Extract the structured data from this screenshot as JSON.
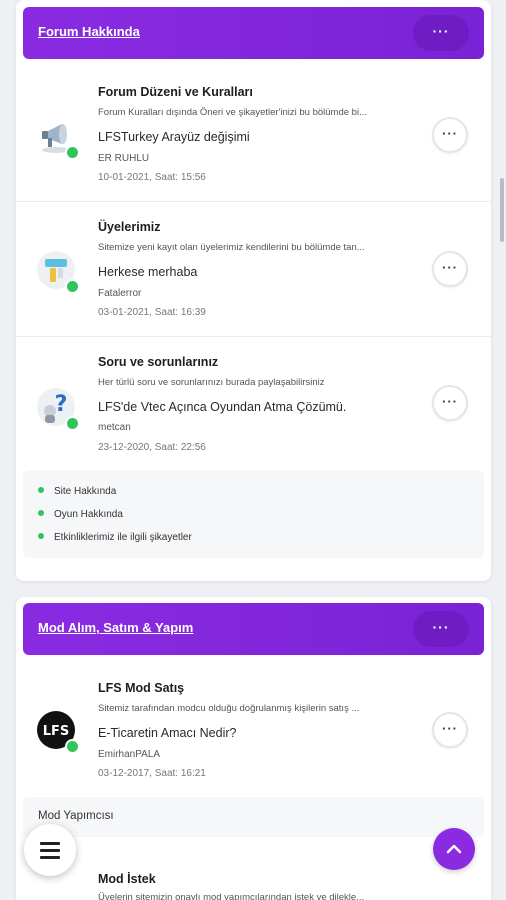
{
  "categories": [
    {
      "title": "Forum Hakkında",
      "more_label": "···",
      "forums": [
        {
          "title": "Forum Düzeni ve Kuralları",
          "description": "Forum Kuralları dışında Öneri ve şikayetler'inizi bu bölümde bi...",
          "last_thread": "LFSTurkey Arayüz değişimi",
          "last_user": "ER RUHLU",
          "last_date": "10-01-2021, Saat: 15:56",
          "icon": "megaphone-icon",
          "more_label": "···"
        },
        {
          "title": "Üyelerimiz",
          "description": "Sitemize yeni kayıt olan üyelerimiz kendilerini bu bölümde tan...",
          "last_thread": "Herkese merhaba",
          "last_user": "Fatalerror",
          "last_date": "03-01-2021, Saat: 16:39",
          "icon": "members-icon",
          "more_label": "···"
        },
        {
          "title": "Soru ve sorunlarınız",
          "description": "Her türlü soru ve sorunlarınızı burada paylaşabilirsiniz",
          "last_thread": "LFS'de Vtec Açınca Oyundan Atma Çözümü.",
          "last_user": "metcan",
          "last_date": "23-12-2020, Saat: 22:56",
          "icon": "question-icon",
          "more_label": "···"
        }
      ],
      "subforums": [
        "Site Hakkında",
        "Oyun Hakkında",
        "Etkinliklerimiz ile ilgili şikayetler"
      ]
    },
    {
      "title": "Mod Alım, Satım & Yapım",
      "more_label": "···",
      "forums": [
        {
          "title": "LFS Mod Satış",
          "description": "Sitemiz tarafından modcu olduğu doğrulanmış kişilerin satış ...",
          "last_thread": "E-Ticaretin Amacı Nedir?",
          "last_user": "EmirhanPALA",
          "last_date": "03-12-2017, Saat: 16:21",
          "icon": "lfs-logo-icon",
          "more_label": "···"
        }
      ],
      "subsection": "Mod Yapımcısı",
      "next_forum": {
        "title": "Mod İstek",
        "description": "Üyelerin sitemizin onaylı mod yapımcılarından istek ve dilekle..."
      }
    }
  ],
  "colors": {
    "accent": "#8a2be2",
    "online": "#2ec55a"
  }
}
